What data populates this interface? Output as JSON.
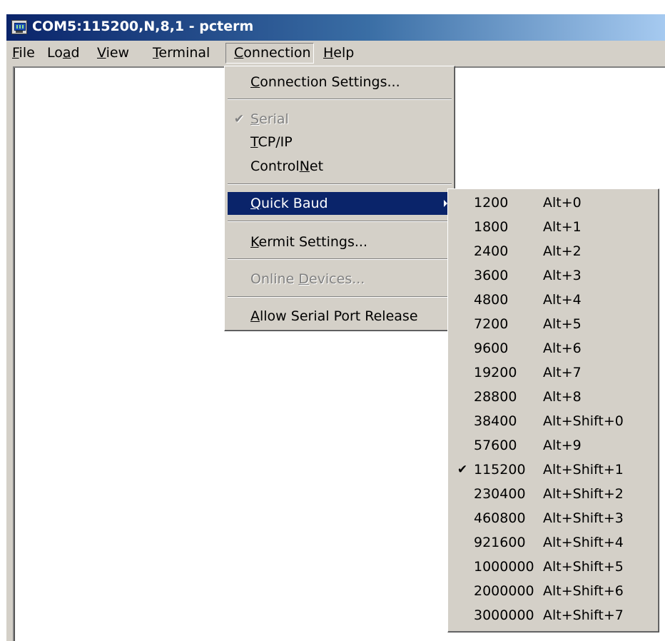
{
  "window": {
    "title": "COM5:115200,N,8,1 - pcterm"
  },
  "menubar": {
    "items": [
      {
        "label_pre": "",
        "label_u": "F",
        "label_post": "ile"
      },
      {
        "label_pre": "Lo",
        "label_u": "a",
        "label_post": "d"
      },
      {
        "label_pre": "",
        "label_u": "V",
        "label_post": "iew"
      },
      {
        "label_pre": "",
        "label_u": "T",
        "label_post": "erminal"
      },
      {
        "label_pre": "",
        "label_u": "C",
        "label_post": "onnection"
      },
      {
        "label_pre": "",
        "label_u": "H",
        "label_post": "elp"
      }
    ],
    "active": "Connection"
  },
  "connection_menu": {
    "items": [
      {
        "pre": "",
        "u": "C",
        "post": "onnection Settings...",
        "disabled": false,
        "checked": false
      },
      {
        "pre": "",
        "u": "S",
        "post": "erial",
        "disabled": true,
        "checked": true
      },
      {
        "pre": "",
        "u": "T",
        "post": "CP/IP",
        "disabled": false,
        "checked": false
      },
      {
        "pre": "Control",
        "u": "N",
        "post": "et",
        "disabled": false,
        "checked": false
      },
      {
        "pre": "",
        "u": "Q",
        "post": "uick Baud",
        "disabled": false,
        "checked": false,
        "submenu": true,
        "highlighted": true
      },
      {
        "pre": "",
        "u": "K",
        "post": "ermit Settings...",
        "disabled": false,
        "checked": false
      },
      {
        "pre": "Online ",
        "u": "D",
        "post": "evices...",
        "disabled": true,
        "checked": false
      },
      {
        "pre": "",
        "u": "A",
        "post": "llow Serial Port Release",
        "disabled": false,
        "checked": false
      }
    ],
    "check_glyph": "✔"
  },
  "quick_baud_menu": {
    "items": [
      {
        "rate": "1200",
        "shortcut": "Alt+0",
        "checked": false
      },
      {
        "rate": "1800",
        "shortcut": "Alt+1",
        "checked": false
      },
      {
        "rate": "2400",
        "shortcut": "Alt+2",
        "checked": false
      },
      {
        "rate": "3600",
        "shortcut": "Alt+3",
        "checked": false
      },
      {
        "rate": "4800",
        "shortcut": "Alt+4",
        "checked": false
      },
      {
        "rate": "7200",
        "shortcut": "Alt+5",
        "checked": false
      },
      {
        "rate": "9600",
        "shortcut": "Alt+6",
        "checked": false
      },
      {
        "rate": "19200",
        "shortcut": "Alt+7",
        "checked": false
      },
      {
        "rate": "28800",
        "shortcut": "Alt+8",
        "checked": false
      },
      {
        "rate": "38400",
        "shortcut": "Alt+Shift+0",
        "checked": false
      },
      {
        "rate": "57600",
        "shortcut": "Alt+9",
        "checked": false
      },
      {
        "rate": "115200",
        "shortcut": "Alt+Shift+1",
        "checked": true
      },
      {
        "rate": "230400",
        "shortcut": "Alt+Shift+2",
        "checked": false
      },
      {
        "rate": "460800",
        "shortcut": "Alt+Shift+3",
        "checked": false
      },
      {
        "rate": "921600",
        "shortcut": "Alt+Shift+4",
        "checked": false
      },
      {
        "rate": "1000000",
        "shortcut": "Alt+Shift+5",
        "checked": false
      },
      {
        "rate": "2000000",
        "shortcut": "Alt+Shift+6",
        "checked": false
      },
      {
        "rate": "3000000",
        "shortcut": "Alt+Shift+7",
        "checked": false
      }
    ],
    "check_glyph": "✔"
  },
  "colors": {
    "face": "#d4d0c8",
    "highlight": "#0a246a",
    "title_start": "#0a246a",
    "title_end": "#a6caf0",
    "disabled_text": "#808080"
  }
}
